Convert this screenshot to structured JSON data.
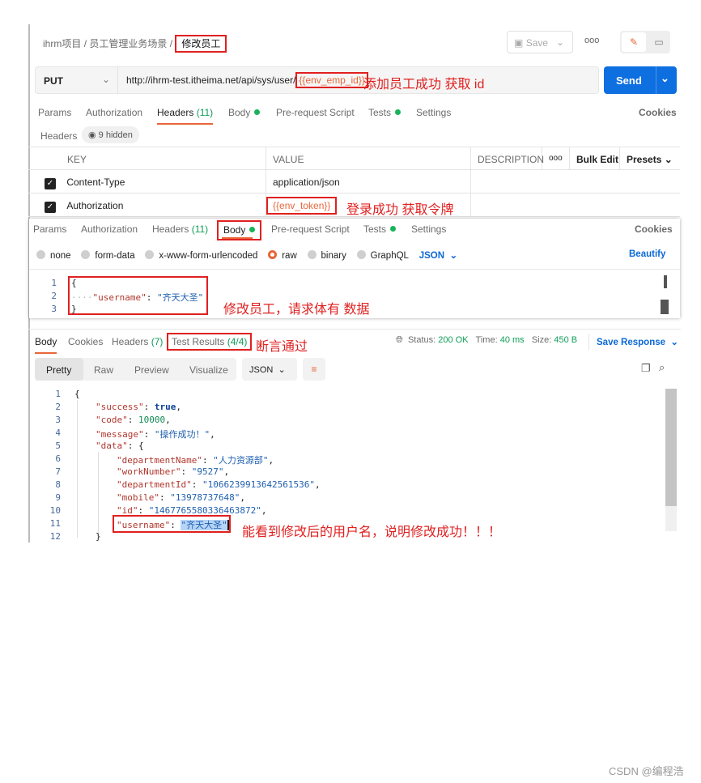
{
  "breadcrumb": {
    "project": "ihrm项目",
    "folder": "员工管理业务场景",
    "current": "修改员工"
  },
  "toolbar": {
    "save": "Save",
    "more": "ooo"
  },
  "request": {
    "method": "PUT",
    "url_base": "http://ihrm-test.itheima.net/api/sys/user/",
    "url_var": "{{env_emp_id}}",
    "send": "Send"
  },
  "annotations": {
    "url": "添加员工成功 获取 id",
    "token": "登录成功 获取令牌",
    "body": "修改员工，请求体有 数据",
    "tests": "断言通过",
    "result": "能看到修改后的用户名，说明修改成功！！！"
  },
  "req_tabs": {
    "params": "Params",
    "authorization": "Authorization",
    "headers": "Headers",
    "headers_count": "(11)",
    "body": "Body",
    "prerequest": "Pre-request Script",
    "tests": "Tests",
    "settings": "Settings",
    "cookies": "Cookies"
  },
  "headers_bar": {
    "label": "Headers",
    "hidden": "9 hidden"
  },
  "headers_table": {
    "columns": [
      "KEY",
      "VALUE",
      "DESCRIPTION"
    ],
    "more": "ooo",
    "bulk_edit": "Bulk Edit",
    "presets": "Presets",
    "rows": [
      {
        "key": "Content-Type",
        "value": "application/json"
      },
      {
        "key": "Authorization",
        "value": "{{env_token}}"
      }
    ]
  },
  "body_types": {
    "none": "none",
    "form_data": "form-data",
    "urlencoded": "x-www-form-urlencoded",
    "raw": "raw",
    "binary": "binary",
    "graphql": "GraphQL",
    "format": "JSON",
    "beautify": "Beautify"
  },
  "request_body": {
    "lines": [
      "{",
      "    \"username\": \"齐天大圣\"",
      "}"
    ]
  },
  "res_tabs": {
    "body": "Body",
    "cookies": "Cookies",
    "headers": "Headers",
    "headers_count": "(7)",
    "tests": "Test Results",
    "tests_count": "(4/4)"
  },
  "status": {
    "status_label": "Status:",
    "status": "200 OK",
    "time_label": "Time:",
    "time": "40 ms",
    "size_label": "Size:",
    "size": "450 B",
    "save_response": "Save Response"
  },
  "res_view": {
    "pretty": "Pretty",
    "raw": "Raw",
    "preview": "Preview",
    "visualize": "Visualize",
    "format": "JSON"
  },
  "response": {
    "success": "true",
    "code": "10000",
    "message": "\"操作成功！\"",
    "departmentName": "\"人力资源部\"",
    "workNumber": "\"9527\"",
    "departmentId": "\"1066239913642561536\"",
    "mobile": "\"13978737648\"",
    "id": "\"1467765580336463872\"",
    "username": "\"齐天大圣\""
  },
  "watermark": "CSDN @编程浩"
}
